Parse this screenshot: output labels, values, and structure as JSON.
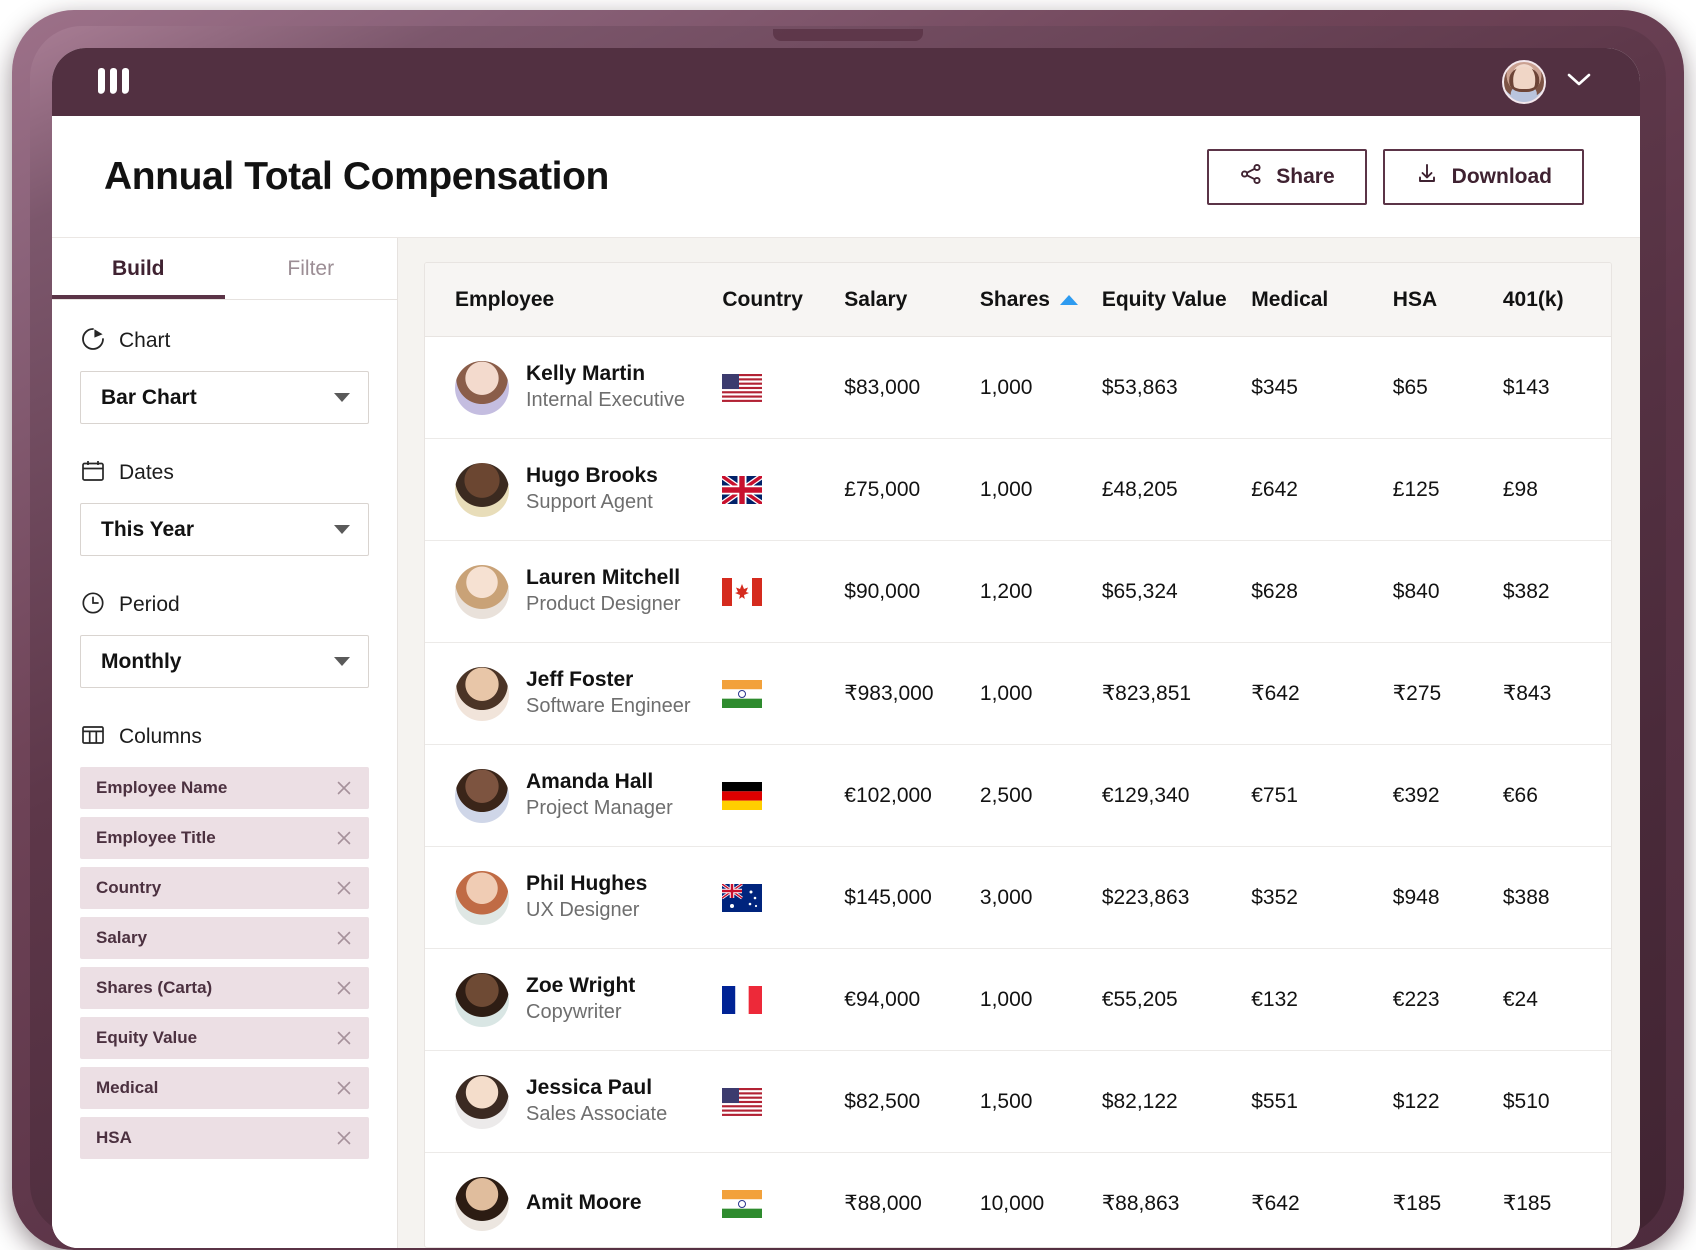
{
  "topbar": {
    "brand": "rippling-logo",
    "avatar_alt": "user-avatar",
    "chevron": "chevron-down-icon"
  },
  "header": {
    "title": "Annual Total Compensation",
    "share_label": "Share",
    "download_label": "Download"
  },
  "sidebar": {
    "tabs": [
      {
        "label": "Build",
        "active": true
      },
      {
        "label": "Filter",
        "active": false
      }
    ],
    "groups": [
      {
        "icon": "pie-chart-icon",
        "label": "Chart",
        "value": "Bar Chart",
        "toggle": true
      },
      {
        "icon": "calendar-icon",
        "label": "Dates",
        "value": "This Year"
      },
      {
        "icon": "clock-icon",
        "label": "Period",
        "value": "Monthly"
      }
    ],
    "columns_label": "Columns",
    "columns_icon": "table-columns-icon",
    "columns": [
      "Employee Name",
      "Employee Title",
      "Country",
      "Salary",
      "Shares (Carta)",
      "Equity Value",
      "Medical",
      "HSA"
    ]
  },
  "table": {
    "headers": [
      {
        "label": "Employee",
        "sorted": false
      },
      {
        "label": "Country",
        "sorted": false
      },
      {
        "label": "Salary",
        "sorted": false
      },
      {
        "label": "Shares",
        "sorted": true
      },
      {
        "label": "Equity Value",
        "sorted": false
      },
      {
        "label": "Medical",
        "sorted": false
      },
      {
        "label": "HSA",
        "sorted": false
      },
      {
        "label": "401(k)",
        "sorted": false
      }
    ],
    "sort_icon_color": "#2e9bf0",
    "rows": [
      {
        "name": "Kelly Martin",
        "title": "Internal Executive",
        "country": "us",
        "salary": "$83,000",
        "shares": "1,000",
        "equity": "$53,863",
        "medical": "$345",
        "hsa": "$65",
        "k401": "$143"
      },
      {
        "name": "Hugo Brooks",
        "title": "Support Agent",
        "country": "gb",
        "salary": "£75,000",
        "shares": "1,000",
        "equity": "£48,205",
        "medical": "£642",
        "hsa": "£125",
        "k401": "£98"
      },
      {
        "name": "Lauren Mitchell",
        "title": "Product Designer",
        "country": "ca",
        "salary": "$90,000",
        "shares": "1,200",
        "equity": "$65,324",
        "medical": "$628",
        "hsa": "$840",
        "k401": "$382"
      },
      {
        "name": "Jeff Foster",
        "title": "Software Engineer",
        "country": "in",
        "salary": "₹983,000",
        "shares": "1,000",
        "equity": "₹823,851",
        "medical": "₹642",
        "hsa": "₹275",
        "k401": "₹843"
      },
      {
        "name": "Amanda Hall",
        "title": "Project Manager",
        "country": "de",
        "salary": "€102,000",
        "shares": "2,500",
        "equity": "€129,340",
        "medical": "€751",
        "hsa": "€392",
        "k401": "€66"
      },
      {
        "name": "Phil Hughes",
        "title": "UX Designer",
        "country": "au",
        "salary": "$145,000",
        "shares": "3,000",
        "equity": "$223,863",
        "medical": "$352",
        "hsa": "$948",
        "k401": "$388"
      },
      {
        "name": "Zoe Wright",
        "title": "Copywriter",
        "country": "fr",
        "salary": "€94,000",
        "shares": "1,000",
        "equity": "€55,205",
        "medical": "€132",
        "hsa": "€223",
        "k401": "€24"
      },
      {
        "name": "Jessica Paul",
        "title": "Sales Associate",
        "country": "us",
        "salary": "$82,500",
        "shares": "1,500",
        "equity": "$82,122",
        "medical": "$551",
        "hsa": "$122",
        "k401": "$510"
      },
      {
        "name": "Amit Moore",
        "title": "",
        "country": "in",
        "salary": "₹88,000",
        "shares": "10,000",
        "equity": "₹88,863",
        "medical": "₹642",
        "hsa": "₹185",
        "k401": "₹185"
      }
    ]
  },
  "colors": {
    "brand_plum": "#523041",
    "bezel": "#5b3447",
    "chip_bg": "#ecdfe4",
    "toggle_on": "#3e5bad",
    "sort_blue": "#2e9bf0"
  }
}
